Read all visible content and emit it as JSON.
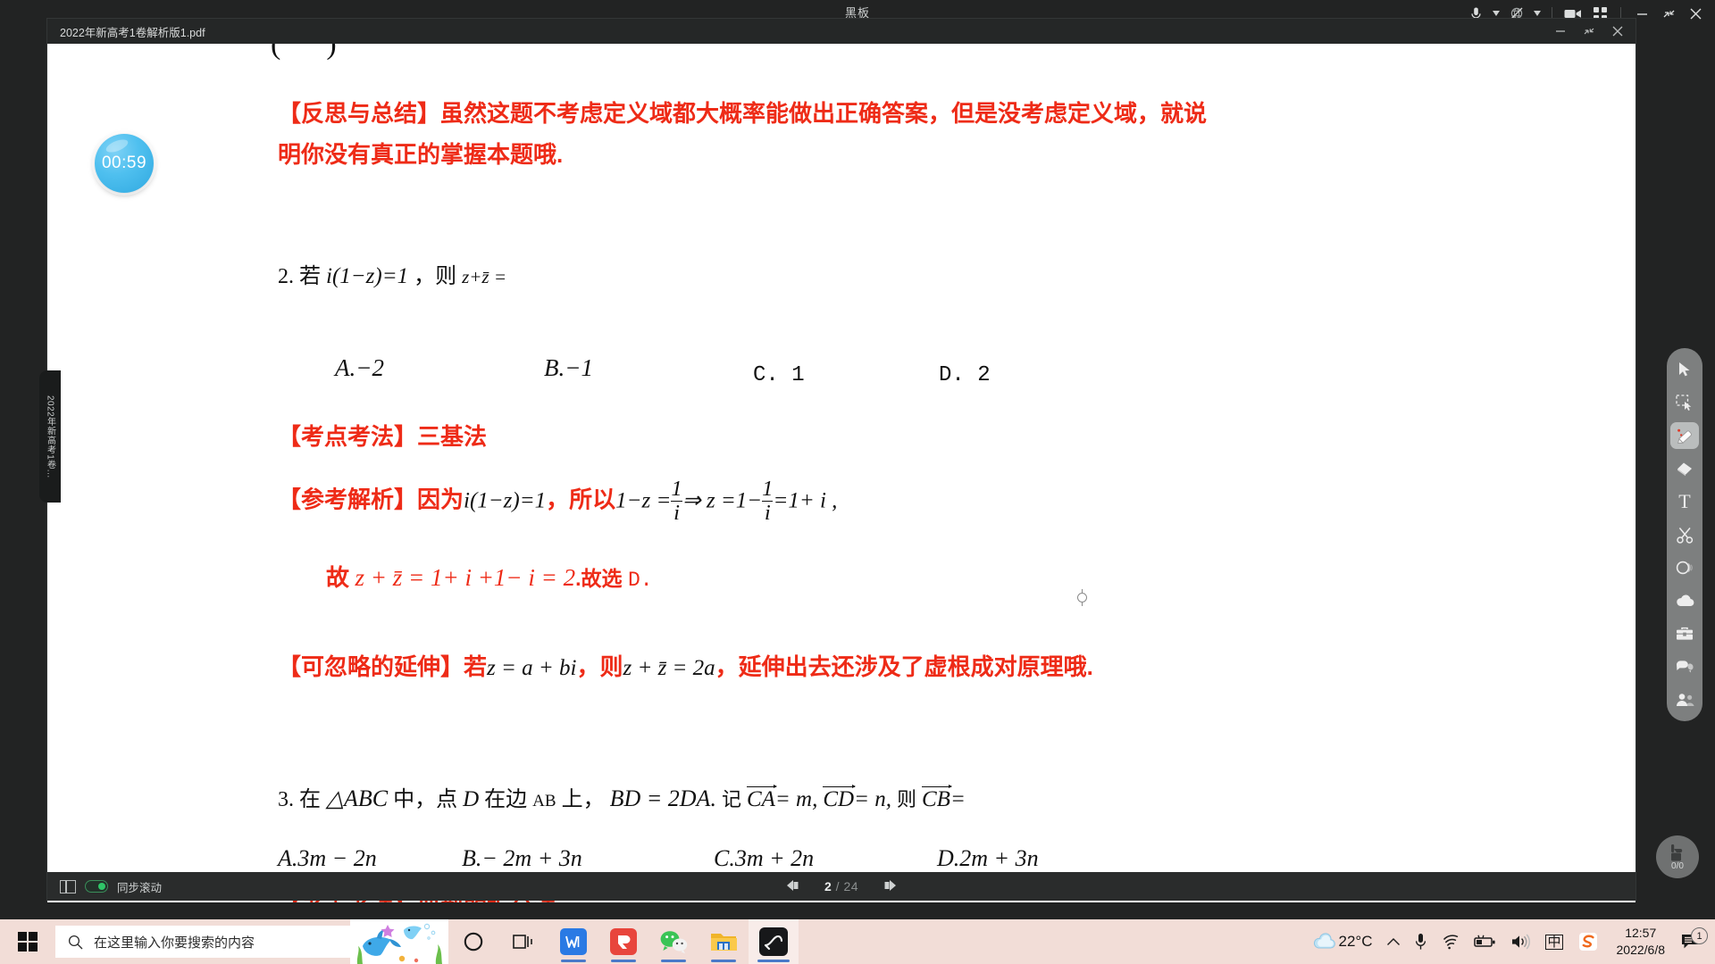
{
  "app": {
    "title": "黑板",
    "titlebar_icons": [
      "microphone-icon",
      "camera-off-icon",
      "video-icon",
      "grid-icon",
      "minimize-icon",
      "restore-icon",
      "close-icon"
    ]
  },
  "doc_window": {
    "tab_label": "2022年新高考1卷解析版1.pdf",
    "controls": [
      "minimize-icon",
      "restore-icon",
      "close-icon"
    ]
  },
  "timer": {
    "value": "00:59"
  },
  "side_tab": {
    "label": "2022年新高考1卷..."
  },
  "bottom_bar": {
    "panel_label": "同步滚动",
    "sync_enabled": true,
    "page_current": "2",
    "page_separator": "/",
    "page_total": "24"
  },
  "raise_hand": {
    "count": "0/0"
  },
  "tool_dock": {
    "tools": [
      {
        "name": "cursor-icon",
        "active": false
      },
      {
        "name": "select-marquee-icon",
        "active": false
      },
      {
        "name": "pen-icon",
        "active": true
      },
      {
        "name": "eraser-icon",
        "active": false
      },
      {
        "name": "text-icon",
        "label": "T",
        "active": false
      },
      {
        "name": "scissors-icon",
        "active": false
      },
      {
        "name": "shape-circle-icon",
        "active": false
      },
      {
        "name": "cloud-icon",
        "active": false
      },
      {
        "name": "toolbox-icon",
        "active": false
      },
      {
        "name": "chat-icon",
        "active": false
      },
      {
        "name": "participants-icon",
        "active": false
      }
    ]
  },
  "document": {
    "reflection": {
      "tag": "【反思与总结】",
      "line1": "虽然这题不考虑定义域都大概率能做出正确答案，但是没考虑定义域，就说",
      "line2": "明你没有真正的掌握本题哦."
    },
    "q2": {
      "number": "2.",
      "stem_pre": "若",
      "expr": "i(1−z)=1",
      "stem_mid": "，则",
      "expr2": "z+z̄ =",
      "options": [
        "A.−2",
        "B.−1",
        "C. 1",
        "D. 2"
      ]
    },
    "q2_point": {
      "tag": "【考点考法】",
      "text": "三基法"
    },
    "q2_solution": {
      "tag": "【参考解析】",
      "because": "因为",
      "expr1": "i(1−z)=1",
      "so": "，所以",
      "expr2_a": "1−z =",
      "expr2_frac_num": "1",
      "expr2_frac_den": "i",
      "expr2_b": "⇒ z =1−",
      "expr2_frac2_num": "1",
      "expr2_frac2_den": "i",
      "expr2_c": "=1+ i ,",
      "line2_pre": "故",
      "line2_expr": "z + z̄ = 1+ i +1− i = 2",
      "line2_post": ".故选",
      "line2_answer": "D."
    },
    "q2_extension": {
      "tag": "【可忽略的延伸】",
      "pre": "若",
      "expr1": "z = a + bi",
      "mid": "，则",
      "expr2": "z + z̄ = 2a",
      "post": "，延伸出去还涉及了虚根成对原理哦."
    },
    "q3": {
      "number": "3.",
      "s1": "在",
      "tri": "△ABC",
      "s2": "中，点",
      "d": "D",
      "s3": "在边",
      "ab": "AB",
      "s4": "上，",
      "bd": "BD = 2DA.",
      "s5": "记",
      "ca": "CA",
      "ca_eq": "= m,",
      "cd": "CD",
      "cd_eq": "= n,",
      "s6": "则",
      "cb": "CB",
      "cb_eq": "=",
      "options": [
        "A.3m − 2n",
        "B.− 2m + 3n",
        "C.3m + 2n",
        "D.2m + 3n"
      ]
    },
    "q3_point": {
      "tag": "【考点考法】",
      "text": "典型的拆分法"
    }
  },
  "taskbar": {
    "start": "start-button",
    "search_placeholder": "在这里输入你要搜索的内容",
    "apps": [
      {
        "name": "cortana-icon",
        "running": false
      },
      {
        "name": "task-view-icon",
        "running": false
      },
      {
        "name": "wps-office-icon",
        "running": true
      },
      {
        "name": "pdf-tool-icon",
        "running": true
      },
      {
        "name": "wechat-icon",
        "running": true
      },
      {
        "name": "file-explorer-icon",
        "running": true
      },
      {
        "name": "blackboard-app-icon",
        "running": true,
        "active": true
      }
    ],
    "tray": {
      "weather_icon": "cloud-icon",
      "temperature": "22°C",
      "chevron": "chevron-up-icon",
      "icons": [
        "microphone-icon",
        "wifi-icon",
        "battery-icon",
        "volume-icon"
      ],
      "ime": "中",
      "sogou": "sogou-icon",
      "time": "12:57",
      "date": "2022/6/8",
      "notification_count": "1"
    }
  },
  "colors": {
    "accent_red": "#ee2b17",
    "taskbar_bg": "#f2ddd7",
    "timer_blue": "#4fc0ef",
    "toggle_green": "#2fc768",
    "app_bg": "#222323"
  }
}
